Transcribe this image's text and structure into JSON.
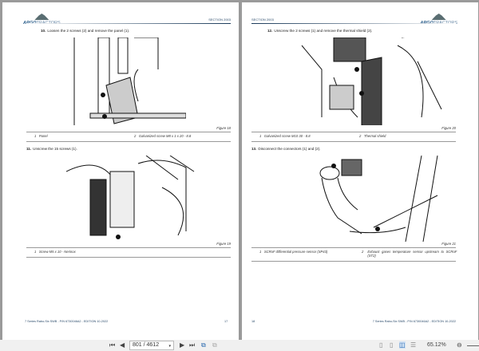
{
  "left_page": {
    "logo": {
      "brand": "ARGO",
      "suffix": "TRACTORS"
    },
    "section": "SECTION 2003",
    "step10": {
      "num": "10.",
      "text": "Loosen the 2 screws (2) and remove the panel (1)."
    },
    "fig18": {
      "caption": "Figure 18",
      "legend": [
        {
          "n": "1",
          "t": "Panel"
        },
        {
          "n": "2",
          "t": "Galvanized screw M8 x 1 x 20 - 8.8"
        }
      ]
    },
    "step11": {
      "num": "11.",
      "text": "Unscrew the 15 screws (1)."
    },
    "fig19": {
      "caption": "Figure 19",
      "legend": [
        {
          "n": "1",
          "t": "Screw M5 x 10 - Nerinox"
        }
      ]
    },
    "footer": "7 Series Rabo-Six SWB - P/N 6730046A2 - EDITION 10-2022",
    "page_num": "17"
  },
  "right_page": {
    "logo": {
      "brand": "ARGO",
      "suffix": "TRACTORS"
    },
    "section": "SECTION 2003",
    "step12": {
      "num": "12.",
      "text": "Unscrew the 2 screws (1) and remove the thermal shield (2)."
    },
    "fig20": {
      "caption": "Figure 20",
      "legend": [
        {
          "n": "1",
          "t": "Galvanized screw M10 30 - 8.8"
        },
        {
          "n": "2",
          "t": "Thermal shield"
        }
      ]
    },
    "step13": {
      "num": "13.",
      "text": "Disconnect the connectors (1) and (2)."
    },
    "fig21": {
      "caption": "Figure 21",
      "legend": [
        {
          "n": "1",
          "t": "SCRoF differential pressure sensor (SP43)"
        },
        {
          "n": "2",
          "t": "Exhaust gases temperature sensor upstream to SCRoF (ST2)"
        }
      ]
    },
    "footer": "7 Series Rabo-Six SWB - P/N 6730046A2 - EDITION 10-2022",
    "page_num": "18"
  },
  "toolbar": {
    "page_field": "801 / 4612",
    "zoom": "65.12%"
  }
}
